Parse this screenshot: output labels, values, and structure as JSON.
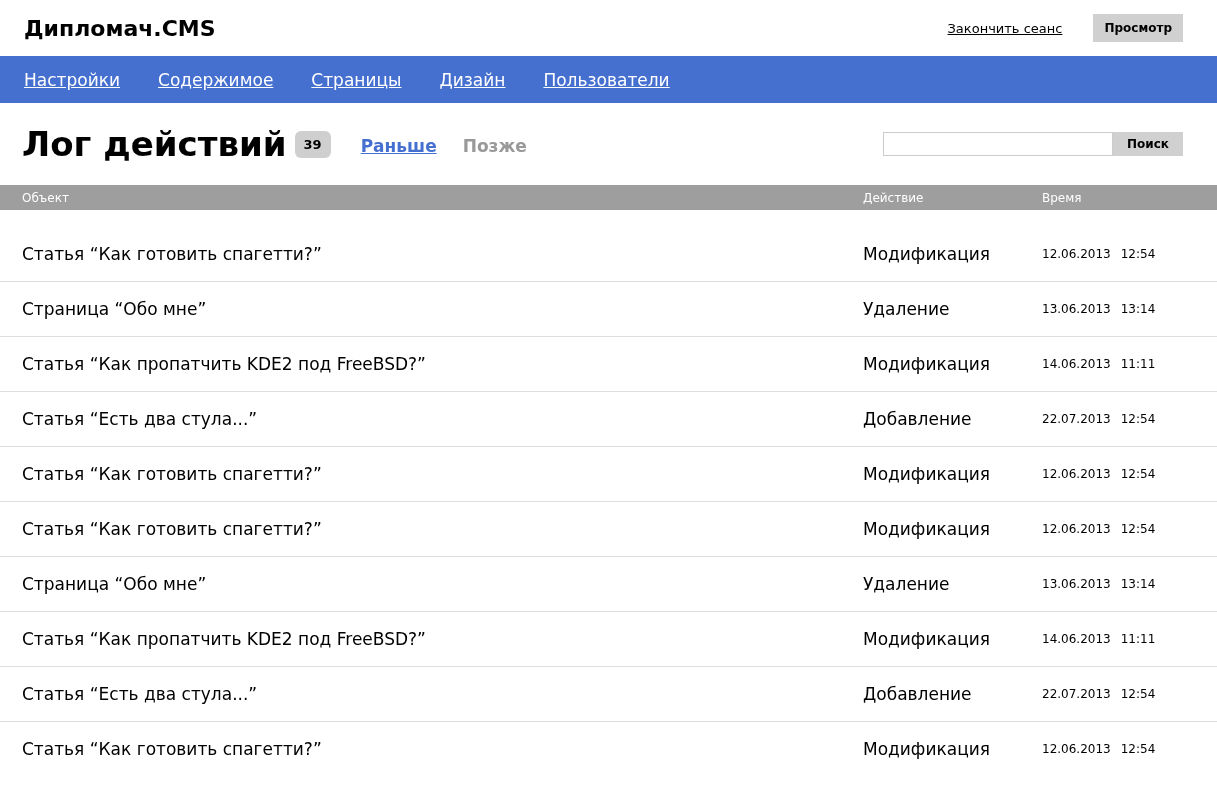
{
  "header": {
    "logo": "Дипломач.CMS",
    "logout": "Закончить сеанс",
    "preview": "Просмотр"
  },
  "nav": [
    {
      "label": "Настройки"
    },
    {
      "label": "Содержимое"
    },
    {
      "label": "Страницы"
    },
    {
      "label": "Дизайн"
    },
    {
      "label": "Пользователи"
    }
  ],
  "page": {
    "title": "Лог действий",
    "count": "39",
    "pager": [
      {
        "label": "Раньше",
        "disabled": false
      },
      {
        "label": "Позже",
        "disabled": true
      }
    ],
    "search": {
      "button": "Поиск"
    }
  },
  "table": {
    "columns": [
      "Объект",
      "Действие",
      "Время"
    ],
    "rows": [
      {
        "object": "Статья “Как готовить спагетти?”",
        "action": "Модификация",
        "date": "12.06.2013",
        "time": "12:54"
      },
      {
        "object": "Страница “Обо мне”",
        "action": "Удаление",
        "date": "13.06.2013",
        "time": "13:14"
      },
      {
        "object": "Статья “Как пропатчить KDE2 под FreeBSD?”",
        "action": "Модификация",
        "date": "14.06.2013",
        "time": "11:11"
      },
      {
        "object": "Статья “Есть два стула...”",
        "action": "Добавление",
        "date": "22.07.2013",
        "time": "12:54"
      },
      {
        "object": "Статья “Как готовить спагетти?”",
        "action": "Модификация",
        "date": "12.06.2013",
        "time": "12:54"
      },
      {
        "object": "Статья “Как готовить спагетти?”",
        "action": "Модификация",
        "date": "12.06.2013",
        "time": "12:54"
      },
      {
        "object": "Страница “Обо мне”",
        "action": "Удаление",
        "date": "13.06.2013",
        "time": "13:14"
      },
      {
        "object": "Статья “Как пропатчить KDE2 под FreeBSD?”",
        "action": "Модификация",
        "date": "14.06.2013",
        "time": "11:11"
      },
      {
        "object": "Статья “Есть два стула...”",
        "action": "Добавление",
        "date": "22.07.2013",
        "time": "12:54"
      },
      {
        "object": "Статья “Как готовить спагетти?”",
        "action": "Модификация",
        "date": "12.06.2013",
        "time": "12:54"
      }
    ]
  }
}
